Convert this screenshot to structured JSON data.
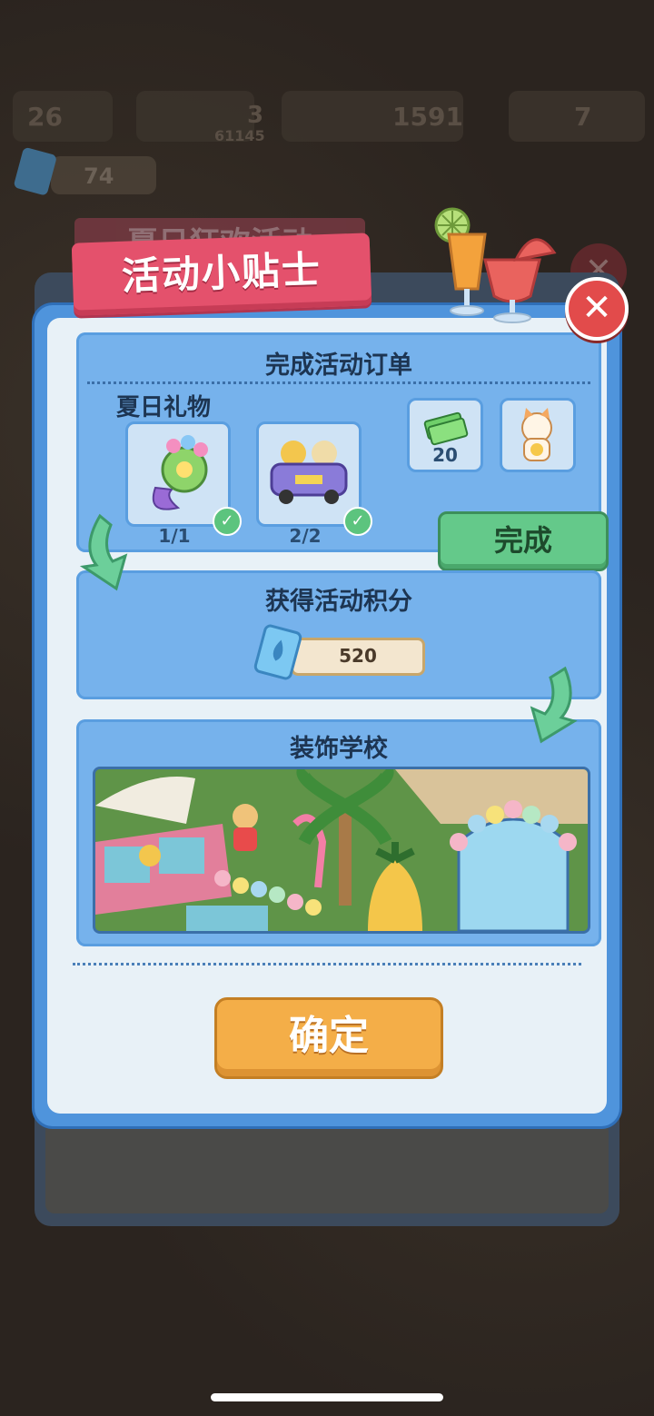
{
  "background": {
    "stat1": "26",
    "stat2": "3",
    "stat3": "1591",
    "stat4": "7",
    "stat_small": "61145",
    "currency_count": "74",
    "ghost_title": "夏日狂欢活动"
  },
  "dialog": {
    "title": "活动小贴士",
    "close_symbol": "✕"
  },
  "section_order": {
    "title": "完成活动订单",
    "subtitle": "夏日礼物",
    "items": [
      {
        "icon": "flower-mermaid-icon",
        "count": "1/1",
        "checked": true
      },
      {
        "icon": "car-characters-icon",
        "count": "2/2",
        "checked": true
      }
    ],
    "rewards": [
      {
        "icon": "cash-icon",
        "value": "20"
      },
      {
        "icon": "lucky-cat-icon",
        "value": ""
      }
    ],
    "complete_button": "完成"
  },
  "section_points": {
    "title": "获得活动积分",
    "points": "520"
  },
  "section_decorate": {
    "title": "装饰学校",
    "scene_icon": "summer-party-scene-illustration"
  },
  "confirm_button": "确定",
  "colors": {
    "panel": "#4f94dc",
    "card": "#76b2ec",
    "ribbon": "#e4516c",
    "confirm": "#f4ae48",
    "complete": "#64c98a",
    "close": "#e24b4b"
  }
}
